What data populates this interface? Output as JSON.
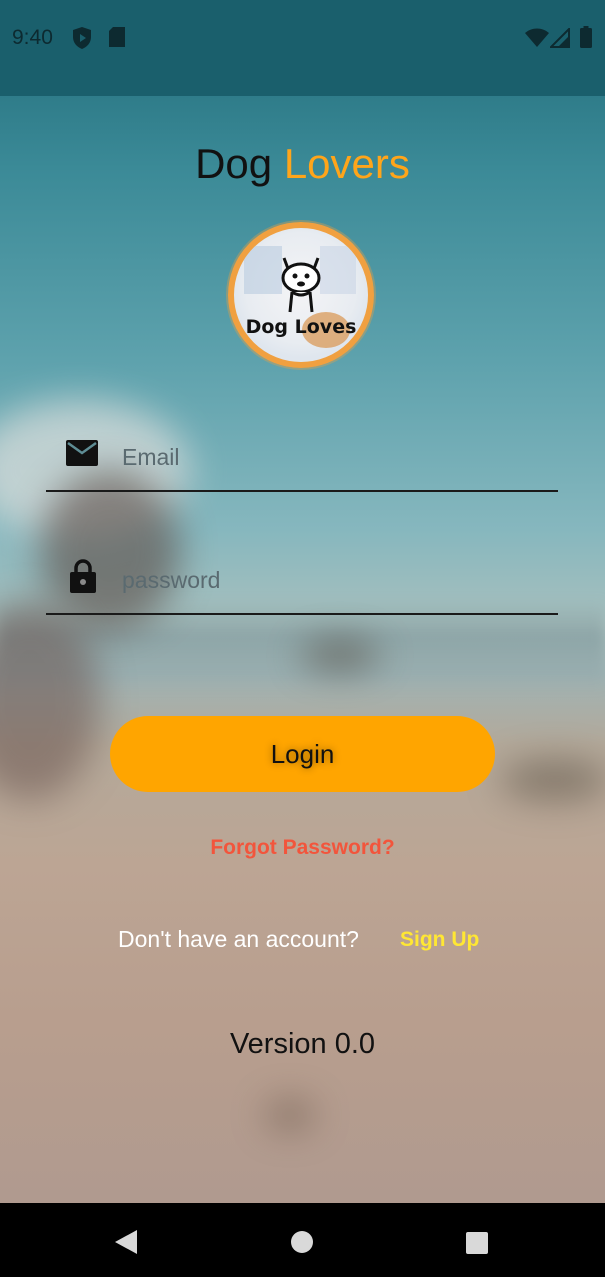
{
  "status_bar": {
    "time": "9:40"
  },
  "title": {
    "word1": "Dog",
    "word2": "Lovers"
  },
  "logo": {
    "text": "Dog Loves"
  },
  "email_field": {
    "placeholder": "Email"
  },
  "password_field": {
    "placeholder": "password"
  },
  "login_button": {
    "label": "Login"
  },
  "forgot_password": {
    "label": "Forgot Password?"
  },
  "signup": {
    "prompt": "Don't have an account?",
    "link": "Sign Up"
  },
  "version": {
    "label": "Version 0.0"
  },
  "colors": {
    "accent": "#ffa500",
    "forgot": "#f2553c",
    "signup": "#ffe733"
  },
  "icons": [
    "shield-icon",
    "sd-card-icon",
    "wifi-icon",
    "signal-icon",
    "battery-icon",
    "mail-icon",
    "lock-icon",
    "back-icon",
    "home-icon",
    "recents-icon"
  ]
}
